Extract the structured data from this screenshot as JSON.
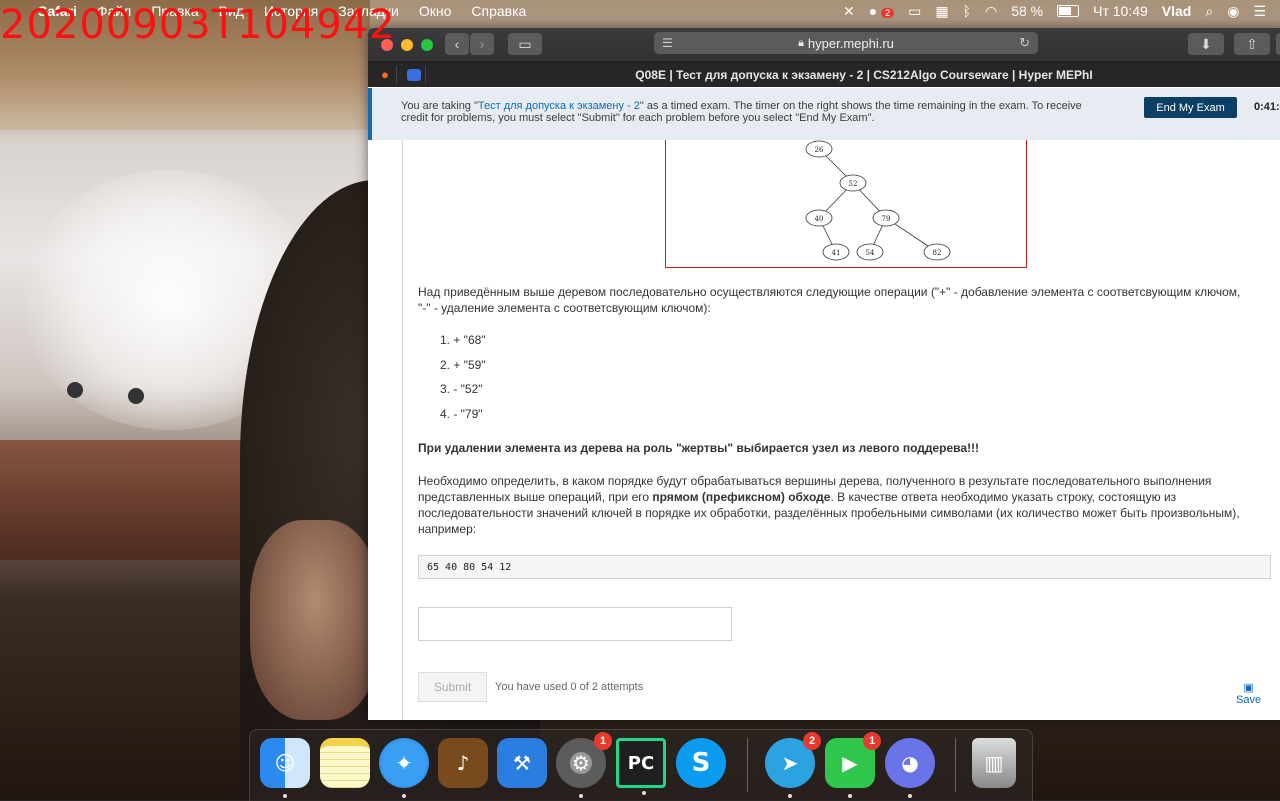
{
  "overlay": {
    "timestamp": "20200903T104942"
  },
  "menubar": {
    "app_name": "Safari",
    "items": [
      "Файл",
      "Правка",
      "Вид",
      "История",
      "Закладки",
      "Окно",
      "Справка"
    ],
    "battery": "58 %",
    "clock": "Чт 10:49",
    "user": "Vlad",
    "notification_badge": "2"
  },
  "browser": {
    "url": "hyper.mephi.ru",
    "tab_title": "Q08E | Тест для допуска к экзамену - 2 | CS212Algo Courseware | Hyper MEPhI"
  },
  "banner": {
    "text_before": "You are taking \"",
    "exam_link": "Тест для допуска к экзамену - 2",
    "text_after": "\" as a timed exam. The timer on the right shows the time remaining in the exam. To receive credit for problems, you must select \"Submit\" for each problem before you select \"End My Exam\".",
    "end_button": "End My Exam",
    "timer": "0:41:"
  },
  "tree": {
    "nodes": [
      {
        "key": "26"
      },
      {
        "key": "52"
      },
      {
        "key": "40"
      },
      {
        "key": "79"
      },
      {
        "key": "41"
      },
      {
        "key": "54"
      },
      {
        "key": "82"
      }
    ]
  },
  "problem": {
    "intro": "Над приведённым выше деревом последовательно осуществляются следующие операции (\"+\" - добавление элемента с соответсвующим ключом, \"-\" - удаление элемента с соответсвующим ключом):",
    "operations": [
      "1.  + \"68\"",
      "2.  + \"59\"",
      "3.  - \"52\"",
      "4.  - \"79\""
    ],
    "warning": "При удалении элемента из дерева на роль \"жертвы\" выбирается узел из левого поддерева!!!",
    "task_part1": "Необходимо определить, в каком порядке будут обрабатываться вершины дерева, полученного в результате последовательного выполнения представленных выше операций, при его ",
    "task_bold": "прямом (префиксном) обходе",
    "task_part2": ". В качестве ответа необходимо указать строку, состоящую из последовательности значений ключей в порядке их обработки, разделённых пробельными символами (их количество может быть произвольным), например:",
    "example": "65 40 80 54 12",
    "answer_value": "",
    "submit_label": "Submit",
    "attempts": "You have used 0 of 2 attempts",
    "save_label": "Save"
  },
  "dock": {
    "items": [
      {
        "name": "finder",
        "badge": ""
      },
      {
        "name": "notes",
        "badge": ""
      },
      {
        "name": "safari",
        "badge": ""
      },
      {
        "name": "garageband",
        "badge": ""
      },
      {
        "name": "xcode",
        "badge": ""
      },
      {
        "name": "system-preferences",
        "badge": "1"
      },
      {
        "name": "pycharm",
        "badge": "",
        "label": "PC"
      },
      {
        "name": "skype",
        "badge": ""
      },
      {
        "name": "telegram",
        "badge": "2"
      },
      {
        "name": "facetime",
        "badge": "1"
      },
      {
        "name": "discord",
        "badge": ""
      },
      {
        "name": "trash",
        "badge": ""
      }
    ]
  }
}
